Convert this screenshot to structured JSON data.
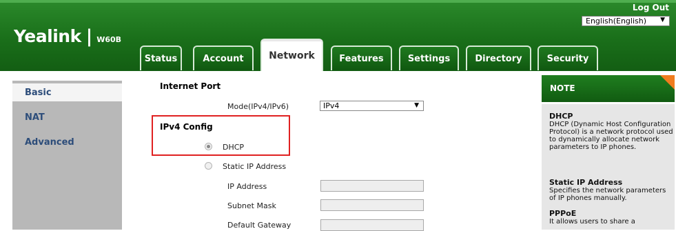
{
  "header": {
    "logo": "Yealink",
    "separator": "|",
    "model": "W60B",
    "logout": "Log Out",
    "language": "English(English)"
  },
  "tabs": [
    {
      "label": "Status"
    },
    {
      "label": "Account"
    },
    {
      "label": "Network"
    },
    {
      "label": "Features"
    },
    {
      "label": "Settings"
    },
    {
      "label": "Directory"
    },
    {
      "label": "Security"
    }
  ],
  "sidebar": {
    "items": [
      {
        "label": "Basic"
      },
      {
        "label": "NAT"
      },
      {
        "label": "Advanced"
      }
    ]
  },
  "main": {
    "internet_port": "Internet Port",
    "mode_label": "Mode(IPv4/IPv6)",
    "mode_value": "IPv4",
    "ipv4_config": "IPv4 Config",
    "dhcp": "DHCP",
    "static_ip": "Static IP Address",
    "ip_address": "IP Address",
    "subnet_mask": "Subnet Mask",
    "default_gateway": "Default Gateway"
  },
  "note": {
    "title": "NOTE",
    "dhcp_title": "DHCP",
    "dhcp_text": "DHCP (Dynamic Host Configuration Protocol) is a network protocol used to dynamically allocate network parameters to IP phones.",
    "static_title": "Static IP Address",
    "static_text": "Specifies the network parameters of IP phones manually.",
    "pppoe_title": "PPPoE",
    "pppoe_text": "It allows users to share a"
  }
}
